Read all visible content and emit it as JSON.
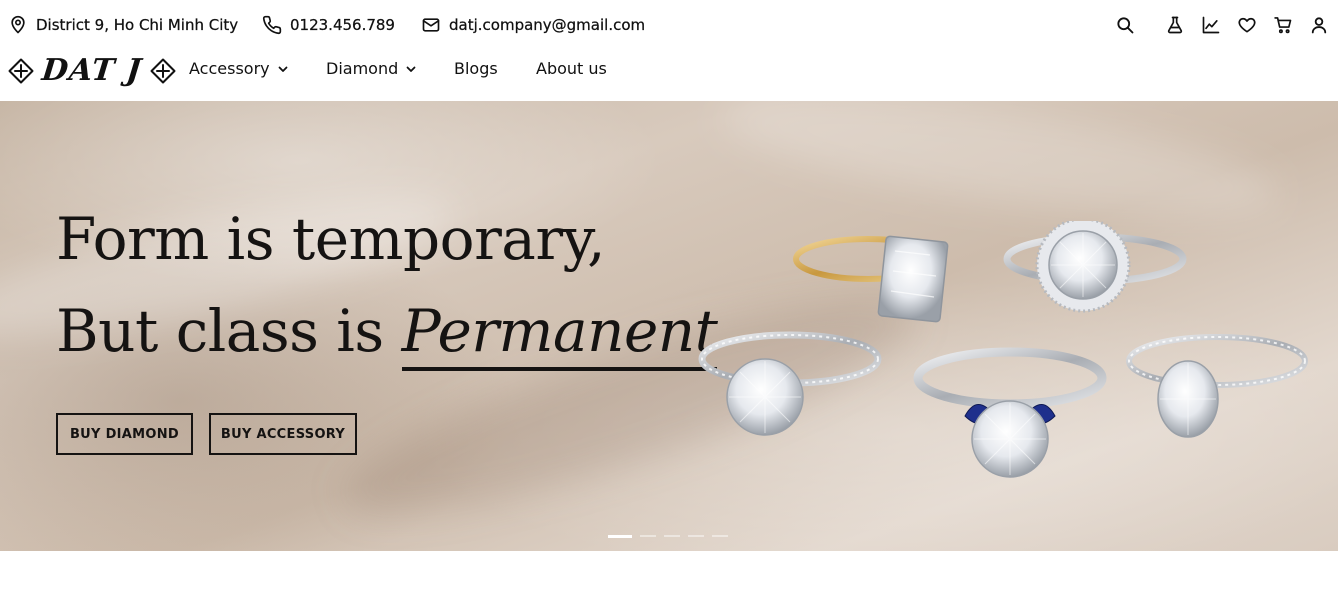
{
  "contact": {
    "address": "District 9, Ho Chi Minh City",
    "phone": "0123.456.789",
    "email": "datj.company@gmail.com"
  },
  "header_icons": [
    "search-icon",
    "flask-icon",
    "chart-icon",
    "heart-icon",
    "cart-icon",
    "user-icon"
  ],
  "logo": {
    "text": "DAT J"
  },
  "nav": {
    "items": [
      {
        "label": "Accessory",
        "has_dropdown": true
      },
      {
        "label": "Diamond",
        "has_dropdown": true
      },
      {
        "label": "Blogs",
        "has_dropdown": false
      },
      {
        "label": "About us",
        "has_dropdown": false
      }
    ]
  },
  "hero": {
    "line1": "Form is temporary,",
    "line2_prefix": "But class is ",
    "line2_emphasis": "Permanent",
    "buttons": {
      "buy_diamond": "BUY DIAMOND",
      "buy_accessory": "BUY ACCESSORY"
    },
    "slide_count": 5,
    "active_slide": 1
  },
  "colors": {
    "text": "#111111",
    "hero_bg": "#d3c4b5",
    "gold": "#d9b36a",
    "silver": "#cfd2d6",
    "sapphire": "#1e2f8c"
  }
}
